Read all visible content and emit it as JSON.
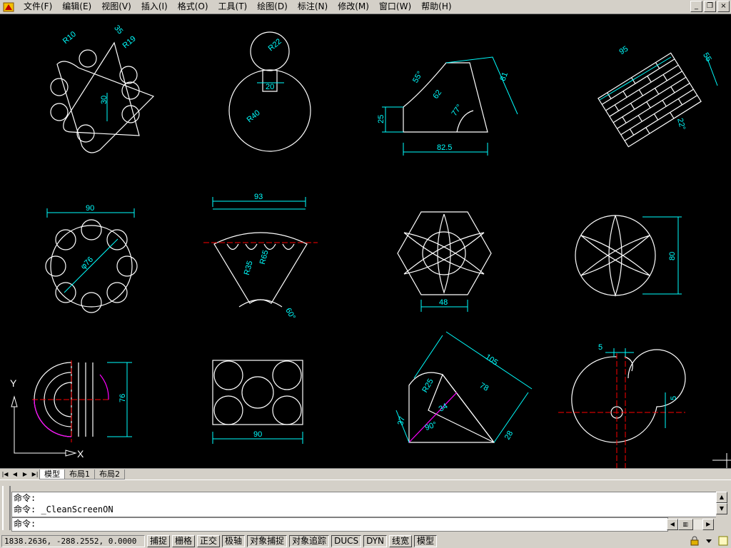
{
  "menu": [
    "文件(F)",
    "编辑(E)",
    "视图(V)",
    "插入(I)",
    "格式(O)",
    "工具(T)",
    "绘图(D)",
    "标注(N)",
    "修改(M)",
    "窗口(W)",
    "帮助(H)"
  ],
  "window_buttons": [
    "_",
    "restore",
    "×"
  ],
  "drawing": {
    "dims": {
      "r10": "R10",
      "r19": "R19",
      "d35": "35",
      "d30": "30",
      "r22": "R22",
      "d20": "20",
      "r40": "R40",
      "a55": "55°",
      "d62": "62",
      "d81": "81",
      "d25": "25",
      "a77": "77°",
      "d825": "82.5",
      "d95": "95",
      "d55": "55",
      "a22": "22°",
      "d90a": "90",
      "phi76": "φ76",
      "d93": "93",
      "r35": "R35",
      "r65": "R65",
      "a60": "60°",
      "d48": "48",
      "d80": "80",
      "d76": "76",
      "d90b": "90",
      "d105": "105",
      "d78": "78",
      "r25": "R25",
      "d34": "34",
      "d37": "37",
      "a90": "90°",
      "d28": "28",
      "d5a": "5",
      "d5b": "5"
    },
    "ucs": {
      "x": "X",
      "y": "Y"
    }
  },
  "tabs": {
    "model": "模型",
    "layout1": "布局1",
    "layout2": "布局2"
  },
  "command": {
    "line1": "命令:",
    "line2": "命令: _CleanScreenON",
    "prompt": "命令:"
  },
  "status": {
    "coords": "1838.2636, -288.2552, 0.0000",
    "toggles": [
      "捕捉",
      "栅格",
      "正交",
      "极轴",
      "对象捕捉",
      "对象追踪",
      "DUCS",
      "DYN",
      "线宽",
      "模型"
    ]
  },
  "colors": {
    "geometry": "#ffffff",
    "dimension": "#00ffff",
    "centerline": "#ff0000",
    "highlight": "#ff00ff"
  }
}
